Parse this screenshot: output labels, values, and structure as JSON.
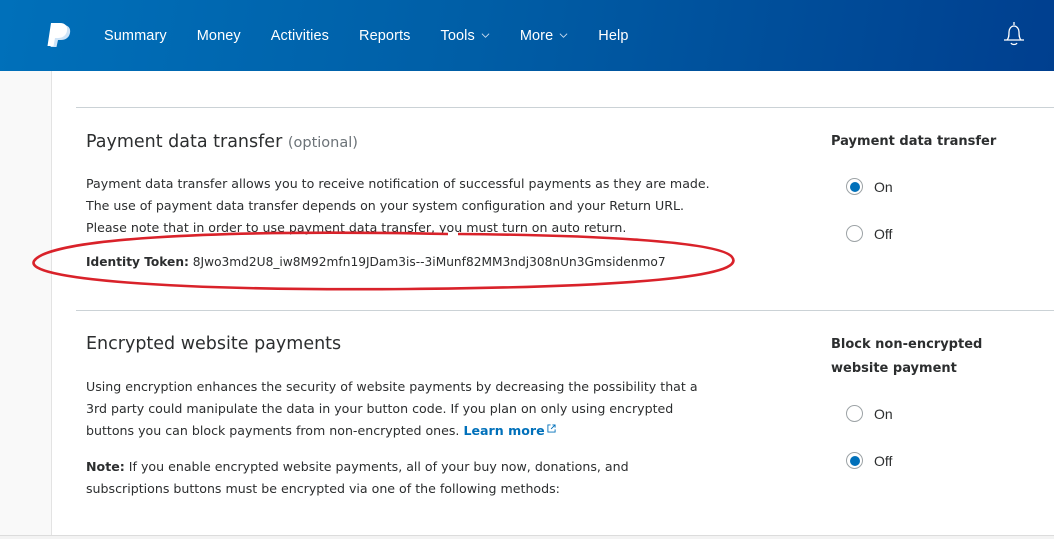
{
  "header": {
    "logo": "paypal-logo",
    "nav": [
      {
        "label": "Summary",
        "has_dropdown": false
      },
      {
        "label": "Money",
        "has_dropdown": false
      },
      {
        "label": "Activities",
        "has_dropdown": false
      },
      {
        "label": "Reports",
        "has_dropdown": false
      },
      {
        "label": "Tools",
        "has_dropdown": true
      },
      {
        "label": "More",
        "has_dropdown": true
      },
      {
        "label": "Help",
        "has_dropdown": false
      }
    ],
    "notification_icon": "bell-icon"
  },
  "pdt": {
    "title": "Payment data transfer",
    "optional": "(optional)",
    "lines": [
      "Payment data transfer allows you to receive notification of successful payments as they are made.",
      "The use of payment data transfer depends on your system configuration and your Return URL.",
      "Please note that in order to use payment data transfer, you must turn on auto return."
    ],
    "token_label": "Identity Token:",
    "token_value": "8Jwo3md2U8_iw8M92mfn19JDam3is--3iMunf82MM3ndj308nUn3Gmsidenmo7",
    "side_label": "Payment data transfer",
    "options": [
      {
        "label": "On",
        "checked": true
      },
      {
        "label": "Off",
        "checked": false
      }
    ]
  },
  "ewp": {
    "title": "Encrypted website payments",
    "lines": [
      "Using encryption enhances the security of website payments by decreasing the possibility that a",
      "3rd party could manipulate the data in your button code. If you plan on only using encrypted",
      "buttons you can block payments from non-encrypted ones."
    ],
    "learn_more": "Learn more",
    "note_label": "Note:",
    "note_lines": [
      " If you enable encrypted website payments, all of your buy now, donations, and",
      "subscriptions buttons must be encrypted via one of the following methods:"
    ],
    "side_label_lines": [
      "Block non-encrypted",
      "website payment"
    ],
    "options": [
      {
        "label": "On",
        "checked": false
      },
      {
        "label": "Off",
        "checked": true
      }
    ]
  },
  "colors": {
    "brand_blue": "#0070ba",
    "annotation_red": "#d9222a"
  }
}
